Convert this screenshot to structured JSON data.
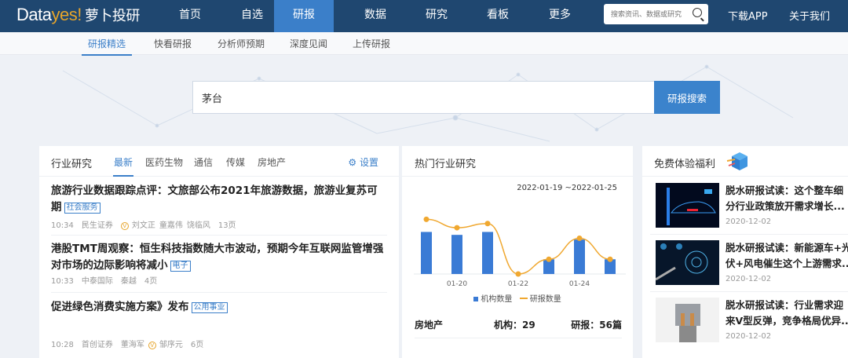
{
  "logo": {
    "text1": "Data",
    "text2": "yes!",
    "text3": "萝卜投研"
  },
  "nav": {
    "items": [
      "首页",
      "自选",
      "研报",
      "数据",
      "研究",
      "看板",
      "更多"
    ],
    "active": "研报",
    "search_placeholder": "搜索资讯、数据或研究",
    "download": "下载APP",
    "about": "关于我们"
  },
  "subnav": {
    "items": [
      "研报精选",
      "快看研报",
      "分析师预期",
      "深度见闻",
      "上传研报"
    ],
    "active": "研报精选"
  },
  "search": {
    "value": "茅台",
    "button": "研报搜索"
  },
  "industry": {
    "title": "行业研究",
    "tabs": [
      "最新",
      "医药生物",
      "通信",
      "传媒",
      "房地产"
    ],
    "settings": "设置",
    "articles": [
      {
        "title": "旅游行业数据跟踪点评：文旅部公布2021年旅游数据，旅游业复苏可期",
        "tag": "社会服务",
        "time": "10:34",
        "broker": "民生证券",
        "authors": [
          "刘文正",
          "童嘉伟",
          "饶临风"
        ],
        "pages": "13页"
      },
      {
        "title": "港股TMT周观察：恒生科技指数随大市波动，预期今年互联网监管增强对市场的边际影响将减小",
        "tag": "电子",
        "time": "10:33",
        "broker": "中泰国际",
        "authors": [
          "秦越"
        ],
        "pages": "4页"
      },
      {
        "title": "促进绿色消费实施方案》发布",
        "tag": "公用事业",
        "time": "10:28",
        "broker": "首创证券",
        "authors": [
          "董海军",
          "邹序元"
        ],
        "pages": "6页"
      }
    ]
  },
  "hot": {
    "title": "热门行业研究",
    "range": "2022-01-19 ~2022-01-25",
    "row": {
      "name": "房地产",
      "inst_label": "机构：",
      "inst": "29",
      "rep_label": "研报：",
      "rep": "56篇"
    }
  },
  "chart_data": {
    "type": "bar",
    "categories": [
      "01-19",
      "01-20",
      "01-21",
      "01-22",
      "01-23",
      "01-24",
      "01-25"
    ],
    "xtick_labels": [
      "01-20",
      "01-22",
      "01-24"
    ],
    "series": [
      {
        "name": "机构数量",
        "type": "bar",
        "color": "#3a7bd5",
        "values": [
          10,
          9.3,
          10,
          0,
          3.5,
          8.2,
          3.5
        ]
      },
      {
        "name": "研报数量",
        "type": "line",
        "color": "#f0a830",
        "values": [
          13,
          11,
          12,
          0,
          3.5,
          8.5,
          3.5
        ]
      }
    ],
    "ylim": [
      0,
      14
    ],
    "legend": "bottom"
  },
  "free": {
    "title": "免费体验福利",
    "items": [
      {
        "title1": "脱水研报试读：这个整车细",
        "title2": "分行业政策放开需求增长...",
        "date": "2020-12-02"
      },
      {
        "title1": "脱水研报试读：新能源车+光",
        "title2": "伏+风电催生这个上游需求...",
        "date": "2020-12-02"
      },
      {
        "title1": "脱水研报试读：行业需求迎",
        "title2": "来V型反弹，竞争格局优异...",
        "date": "2020-12-02"
      }
    ]
  }
}
